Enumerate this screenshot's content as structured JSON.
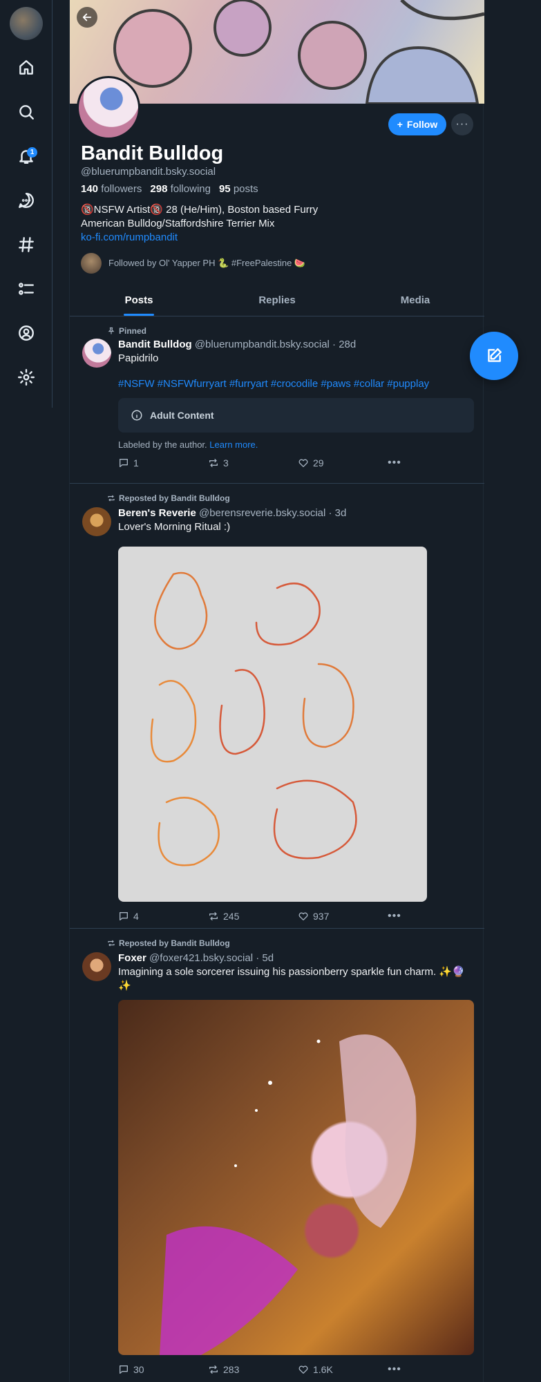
{
  "rail": {
    "notification_count": "1",
    "items": [
      "home",
      "search",
      "notifications",
      "chat",
      "feeds",
      "lists",
      "profile",
      "settings"
    ]
  },
  "profile": {
    "display_name": "Bandit Bulldog",
    "handle": "@bluerumpbandit.bsky.social",
    "follow_label": "Follow",
    "more_label": "···",
    "stats": {
      "followers_count": "140",
      "followers_label": "followers",
      "following_count": "298",
      "following_label": "following",
      "posts_count": "95",
      "posts_label": "posts"
    },
    "bio_line1": "🔞NSFW Artist🔞 28 (He/Him), Boston based Furry",
    "bio_line2": "American Bulldog/Staffordshire Terrier Mix",
    "bio_link": "ko-fi.com/rumpbandit",
    "followed_by": "Followed by Ol' Yapper PH 🐍 #FreePalestine 🍉"
  },
  "tabs": [
    "Posts",
    "Replies",
    "Media"
  ],
  "posts": [
    {
      "meta": "Pinned",
      "author": "Bandit Bulldog",
      "handle_time": "@bluerumpbandit.bsky.social · 28d",
      "text": "Papidrilo",
      "hashtags": "#NSFW #NSFWfurryart #furryart #crocodile #paws #collar #pupplay",
      "content_warning": "Adult Content",
      "labeled_prefix": "Labeled by the author.",
      "labeled_link": "Learn more.",
      "replies": "1",
      "reposts": "3",
      "likes": "29"
    },
    {
      "meta": "Reposted by Bandit Bulldog",
      "author": "Beren's Reverie",
      "handle_time": "@berensreverie.bsky.social · 3d",
      "text": "Lover's Morning Ritual :)",
      "replies": "4",
      "reposts": "245",
      "likes": "937"
    },
    {
      "meta": "Reposted by Bandit Bulldog",
      "author": "Foxer",
      "handle_time": "@foxer421.bsky.social · 5d",
      "text": "Imagining a sole sorcerer issuing his passionberry sparkle fun charm. ✨🔮✨",
      "replies": "30",
      "reposts": "283",
      "likes": "1.6K"
    }
  ],
  "colors": {
    "accent": "#208bfe",
    "background": "#161e27",
    "muted": "#a6b3c1"
  }
}
